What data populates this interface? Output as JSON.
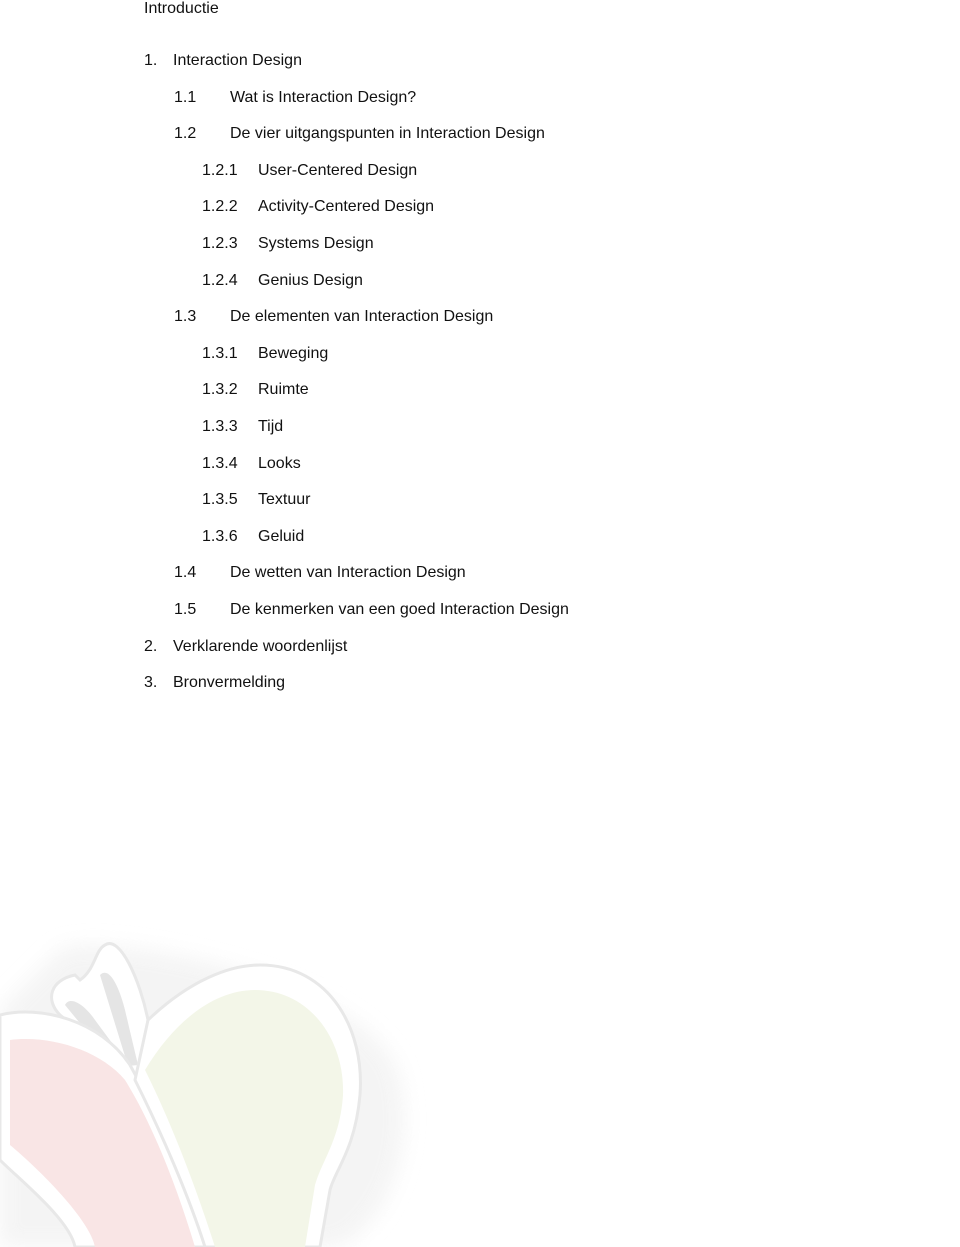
{
  "document": {
    "heading": "Introductie",
    "toc": [
      {
        "number": "1.",
        "label": "Interaction Design",
        "level": 0
      },
      {
        "number": "1.1",
        "label": "Wat is Interaction Design?",
        "level": 1
      },
      {
        "number": "1.2",
        "label": "De vier uitgangspunten in Interaction Design",
        "level": 1
      },
      {
        "number": "1.2.1",
        "label": "User-Centered Design",
        "level": 2
      },
      {
        "number": "1.2.2",
        "label": "Activity-Centered Design",
        "level": 2
      },
      {
        "number": "1.2.3",
        "label": "Systems Design",
        "level": 2
      },
      {
        "number": "1.2.4",
        "label": "Genius Design",
        "level": 2
      },
      {
        "number": "1.3",
        "label": "De elementen van Interaction Design",
        "level": 1
      },
      {
        "number": "1.3.1",
        "label": "Beweging",
        "level": 2
      },
      {
        "number": "1.3.2",
        "label": "Ruimte",
        "level": 2
      },
      {
        "number": "1.3.3",
        "label": "Tijd",
        "level": 2
      },
      {
        "number": "1.3.4",
        "label": "Looks",
        "level": 2
      },
      {
        "number": "1.3.5",
        "label": "Textuur",
        "level": 2
      },
      {
        "number": "1.3.6",
        "label": "Geluid",
        "level": 2
      },
      {
        "number": "1.4",
        "label": "De wetten van Interaction Design",
        "level": 1
      },
      {
        "number": "1.5",
        "label": "De kenmerken van een goed Interaction Design",
        "level": 1
      },
      {
        "number": "2.",
        "label": "Verklarende woordenlijst",
        "level": 0
      },
      {
        "number": "3.",
        "label": "Bronvermelding",
        "level": 0
      }
    ]
  },
  "watermark": {
    "icon": "butterfly-logo-icon",
    "colors": {
      "left_wing": "#f8e4e4",
      "right_wing": "#f3f6e8",
      "antenna": "#e6e6e6",
      "outline": "#e8e8e8"
    }
  },
  "footer": {
    "brand_text_partial": "",
    "brand_color": "#8bc34a"
  }
}
